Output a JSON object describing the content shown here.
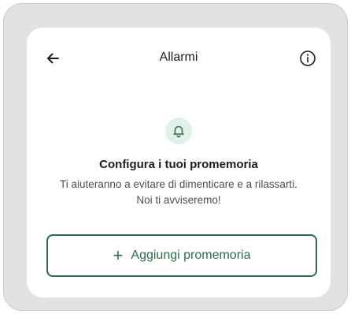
{
  "header": {
    "title": "Allarmi",
    "back_icon": "arrow-left-icon",
    "info_icon": "info-icon"
  },
  "empty_state": {
    "icon": "bell-icon",
    "title": "Configura i tuoi promemoria",
    "description_line1": "Ti aiuteranno a evitare di dimenticare e a rilassarti.",
    "description_line2": "Noi ti avviseremo!"
  },
  "actions": {
    "add_icon": "plus-icon",
    "add_label": "Aggiungi promemoria"
  },
  "colors": {
    "accent": "#2e6b4a",
    "icon_bg": "#e1f0e8",
    "frame_bg": "#e2e3e1"
  }
}
